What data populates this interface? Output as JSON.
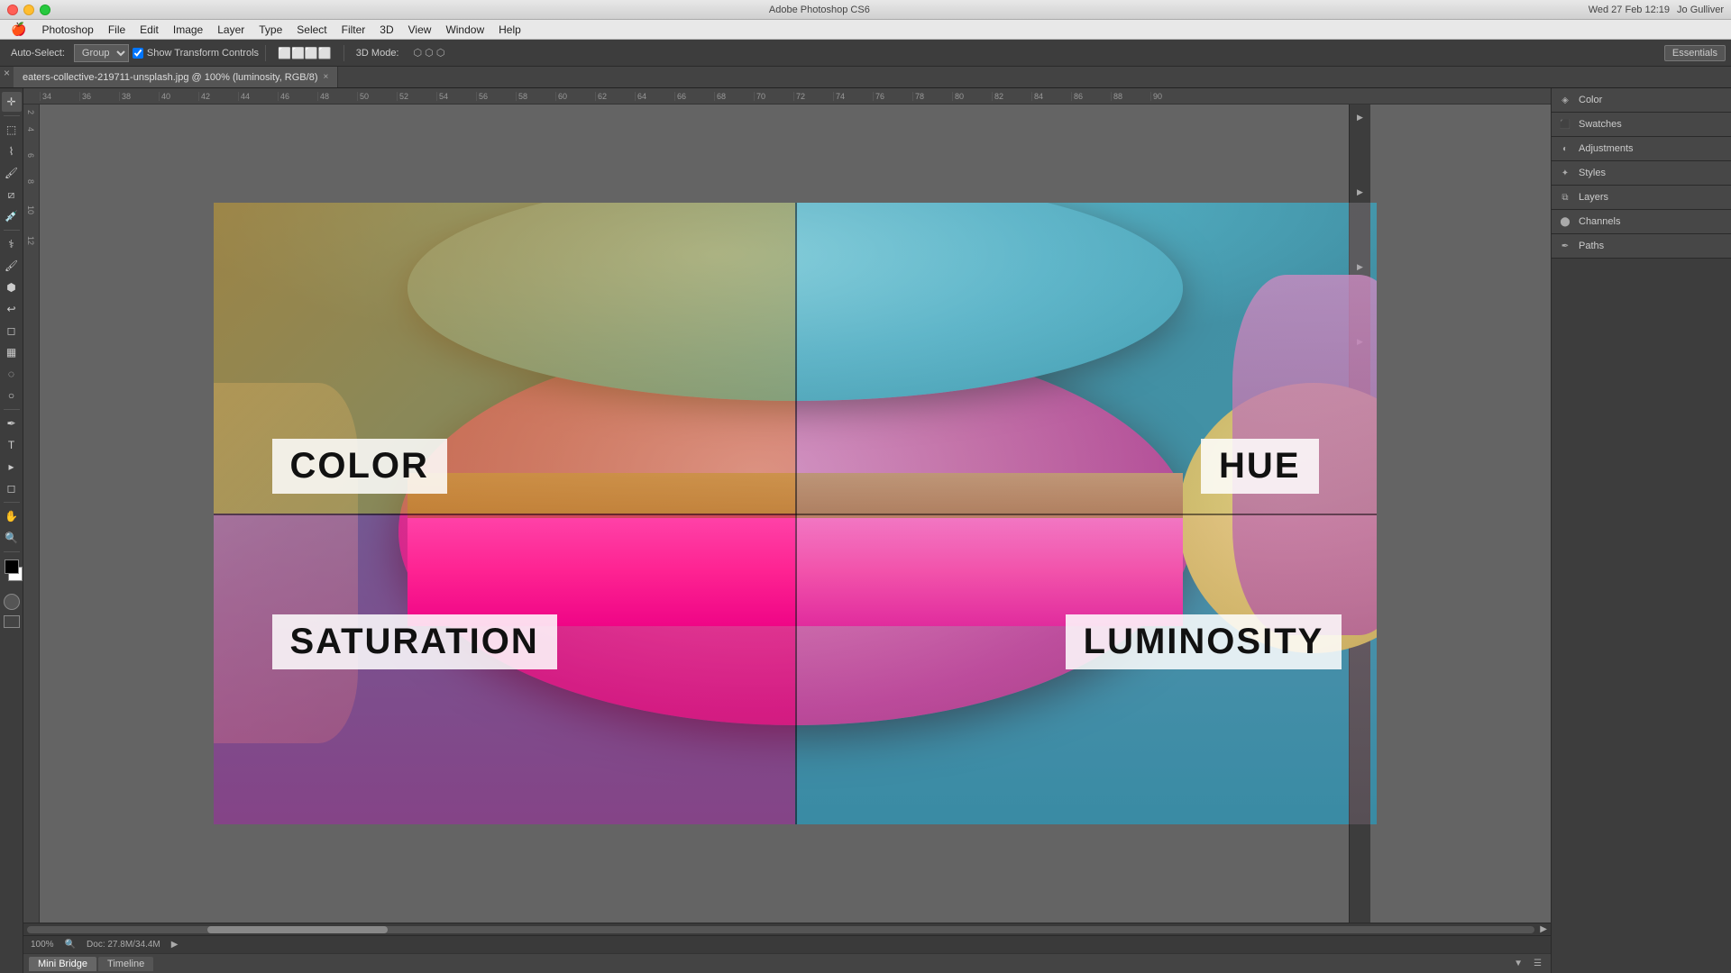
{
  "titlebar": {
    "title": "Adobe Photoshop CS6",
    "time": "Wed 27 Feb  12:19",
    "user": "Jo Gulliver"
  },
  "menu": {
    "apple": "🍎",
    "items": [
      "Photoshop",
      "File",
      "Edit",
      "Image",
      "Layer",
      "Type",
      "Select",
      "Filter",
      "3D",
      "View",
      "Window",
      "Help"
    ]
  },
  "toolbar": {
    "auto_select_label": "Auto-Select:",
    "auto_select_value": "Group",
    "show_transform_label": "Show Transform Controls",
    "mode_3d": "3D Mode:",
    "essentials": "Essentials"
  },
  "tab": {
    "filename": "eaters-collective-219711-unsplash.jpg @ 100% (luminosity, RGB/8)",
    "close": "×"
  },
  "canvas": {
    "labels": {
      "color": "COLOR",
      "hue": "HUE",
      "saturation": "SATURATION",
      "luminosity": "LUMINOSITY"
    }
  },
  "right_panel": {
    "sections": [
      {
        "id": "color",
        "title": "Color"
      },
      {
        "id": "swatches",
        "title": "Swatches"
      },
      {
        "id": "adjustments",
        "title": "Adjustments"
      },
      {
        "id": "styles",
        "title": "Styles"
      },
      {
        "id": "layers",
        "title": "Layers"
      },
      {
        "id": "channels",
        "title": "Channels"
      },
      {
        "id": "paths",
        "title": "Paths"
      }
    ]
  },
  "status_bar": {
    "zoom": "100%",
    "doc_info": "Doc: 27.8M/34.4M"
  },
  "bottom_tabs": [
    {
      "id": "mini-bridge",
      "label": "Mini Bridge"
    },
    {
      "id": "timeline",
      "label": "Timeline"
    }
  ],
  "ruler": {
    "marks": [
      "34",
      "36",
      "38",
      "40",
      "42",
      "44",
      "46",
      "48",
      "50",
      "52",
      "54",
      "56",
      "58",
      "60",
      "62",
      "64",
      "66",
      "68",
      "70",
      "72",
      "74",
      "76",
      "78",
      "80",
      "82",
      "84",
      "86",
      "88",
      "90"
    ]
  }
}
